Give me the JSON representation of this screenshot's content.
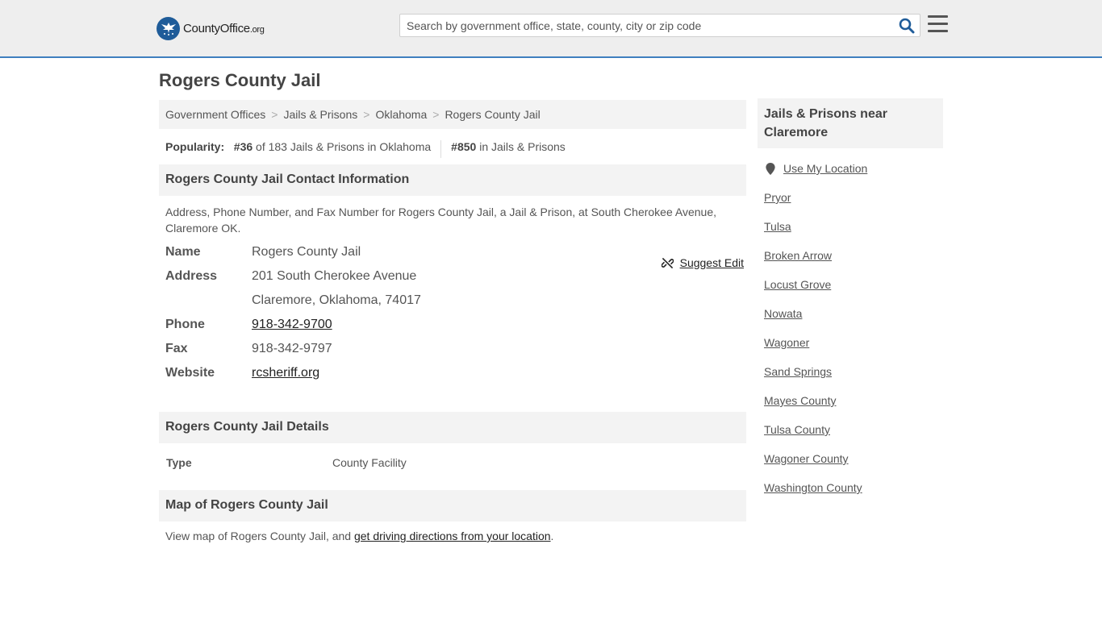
{
  "header": {
    "logo_main": "CountyOffice",
    "logo_tld": ".org",
    "search_placeholder": "Search by government office, state, county, city or zip code",
    "search_icon": "search-icon",
    "menu_icon": "hamburger-menu-icon",
    "accent_color": "#3f7fbf"
  },
  "page": {
    "title": "Rogers County Jail"
  },
  "breadcrumb": [
    "Government Offices",
    "Jails & Prisons",
    "Oklahoma",
    "Rogers County Jail"
  ],
  "popularity": {
    "label": "Popularity:",
    "rank_state": "#36",
    "rank_state_text": "of 183 Jails & Prisons in Oklahoma",
    "rank_national": "#850",
    "rank_national_text": "in Jails & Prisons"
  },
  "contact": {
    "heading": "Rogers County Jail Contact Information",
    "description": "Address, Phone Number, and Fax Number for Rogers County Jail, a Jail & Prison, at South Cherokee Avenue, Claremore OK.",
    "suggest_edit": "Suggest Edit",
    "name_label": "Name",
    "name": "Rogers County Jail",
    "address_label": "Address",
    "address_line1": "201 South Cherokee Avenue",
    "address_line2": "Claremore, Oklahoma, 74017",
    "phone_label": "Phone",
    "phone": "918-342-9700",
    "fax_label": "Fax",
    "fax": "918-342-9797",
    "website_label": "Website",
    "website": "rcsheriff.org"
  },
  "details": {
    "heading": "Rogers County Jail Details",
    "type_label": "Type",
    "type_value": "County Facility"
  },
  "map": {
    "heading": "Map of Rogers County Jail",
    "text_before": "View map of Rogers County Jail, and ",
    "link": "get driving directions from your location",
    "text_after": "."
  },
  "sidebar": {
    "heading": "Jails & Prisons near Claremore",
    "use_location": "Use My Location",
    "items": [
      "Pryor",
      "Tulsa",
      "Broken Arrow",
      "Locust Grove",
      "Nowata",
      "Wagoner",
      "Sand Springs",
      "Mayes County",
      "Tulsa County",
      "Wagoner County",
      "Washington County"
    ]
  }
}
